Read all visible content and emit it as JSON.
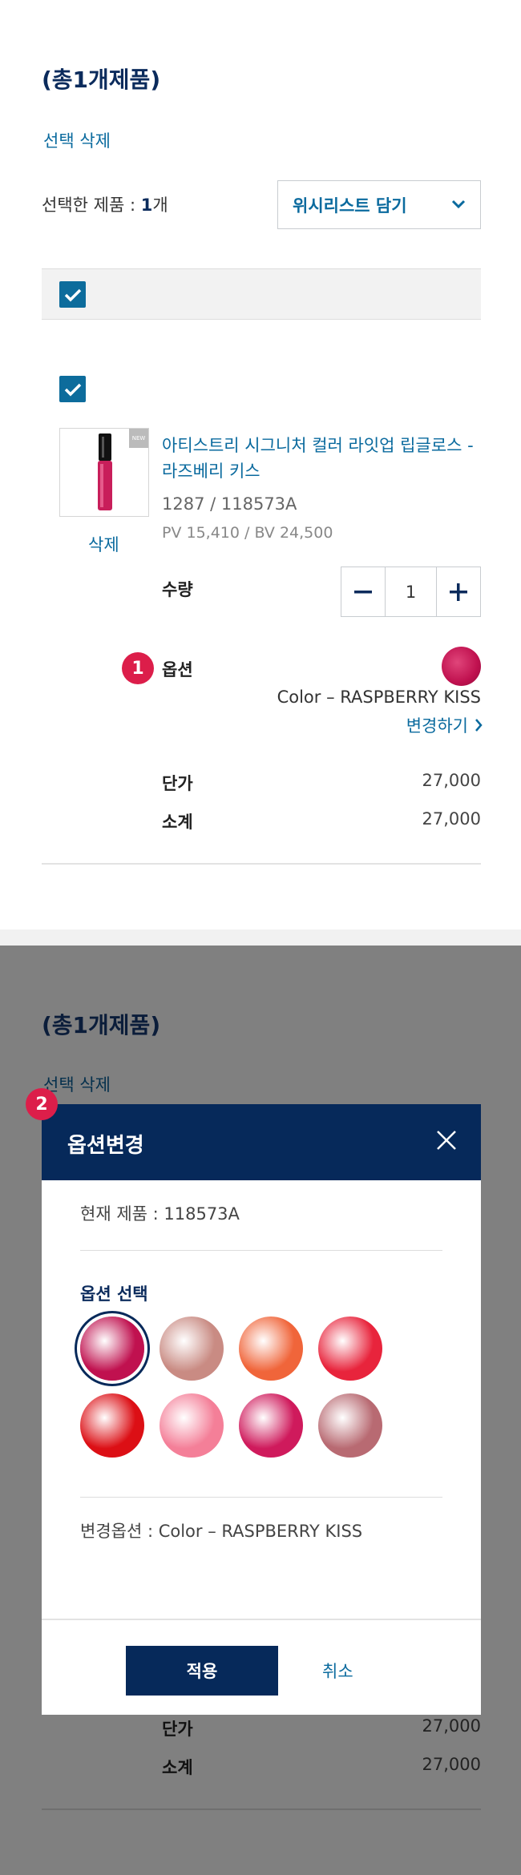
{
  "top": {
    "title": "(총1개제품)",
    "delete_selected": "선택 삭제",
    "selected_count_label": "선택한 제품 : ",
    "selected_count_value": "1",
    "selected_count_unit": "개",
    "wishlist_select": "위시리스트 담기",
    "item": {
      "name": "아티스트리 시그니처 컬러 라잇업 립글로스 - 라즈베리 키스",
      "code": "1287 / 118573A",
      "pv_bv": "PV 15,410 / BV 24,500",
      "delete": "삭제",
      "thumb_tag": "NEW",
      "qty_label": "수량",
      "qty_value": "1",
      "option_label": "옵션",
      "option_value": "Color – RASPBERRY KISS",
      "change_option": "변경하기",
      "unit_price_label": "단가",
      "unit_price": "27,000",
      "subtotal_label": "소계",
      "subtotal": "27,000",
      "swatch_color": "#c0114f"
    },
    "badge": "1"
  },
  "bottom": {
    "title": "(총1개제품)",
    "delete_selected": "선택 삭제",
    "unit_price_label": "단가",
    "unit_price": "27,000",
    "subtotal_label": "소계",
    "subtotal": "27,000",
    "badge": "2"
  },
  "modal": {
    "title": "옵션변경",
    "current_product": "현재 제품 : 118573A",
    "option_select_label": "옵션 선택",
    "swatches": [
      {
        "color": "#c0114f",
        "selected": true
      },
      {
        "color": "#c98b83",
        "selected": false
      },
      {
        "color": "#f0653a",
        "selected": false
      },
      {
        "color": "#e8243c",
        "selected": false
      },
      {
        "color": "#dc0f15",
        "selected": false
      },
      {
        "color": "#f47f98",
        "selected": false
      },
      {
        "color": "#cf1a5c",
        "selected": false
      },
      {
        "color": "#b86a72",
        "selected": false
      }
    ],
    "changed_option": "변경옵션 : Color – RASPBERRY KISS",
    "apply": "적용",
    "cancel": "취소"
  },
  "colors": {
    "navy": "#0b2b5c",
    "accent_blue": "#0a6a9e",
    "badge_red": "#dc1e4a",
    "overlay": "#808080"
  }
}
